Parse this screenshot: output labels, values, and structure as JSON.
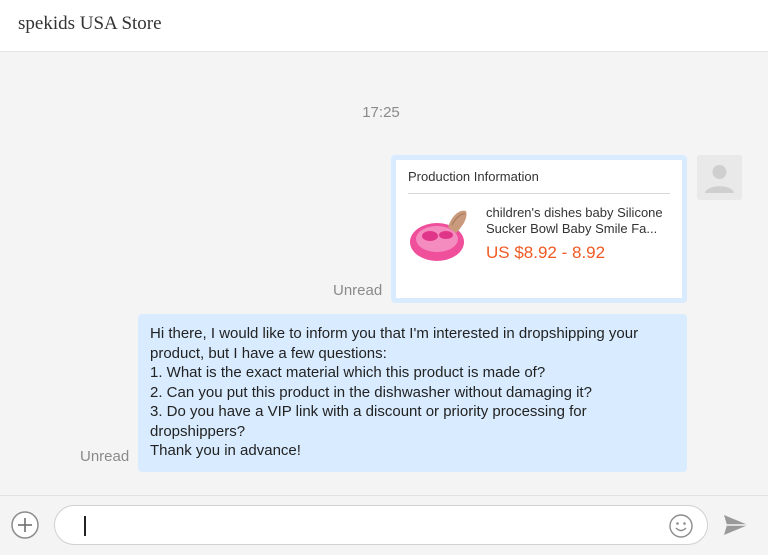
{
  "header": {
    "store_name": "spekids USA Store"
  },
  "conversation": {
    "timestamp": "17:25",
    "product_card": {
      "header": "Production Information",
      "title_line1": "children's dishes baby Silicone",
      "title_line2": "Sucker Bowl Baby Smile Fa...",
      "price": "US $8.92 - 8.92",
      "price_color": "#f05a24",
      "status": "Unread"
    },
    "text_message": {
      "lines": [
        "Hi there, I would like to inform you that I'm interested in dropshipping your",
        "product, but I have a few questions:",
        "1. What is the exact material which this product is made of?",
        "2. Can you put this product in the dishwasher without damaging it?",
        "3. Do you have a VIP link with a discount or priority processing for",
        "dropshippers?",
        "Thank you in advance!"
      ],
      "status": "Unread"
    },
    "bubble_color": "#d9ecff"
  },
  "composer": {
    "input_value": "",
    "add_icon": "plus-circle-icon",
    "emoji_icon": "smiley-icon",
    "send_icon": "paper-plane-icon"
  }
}
